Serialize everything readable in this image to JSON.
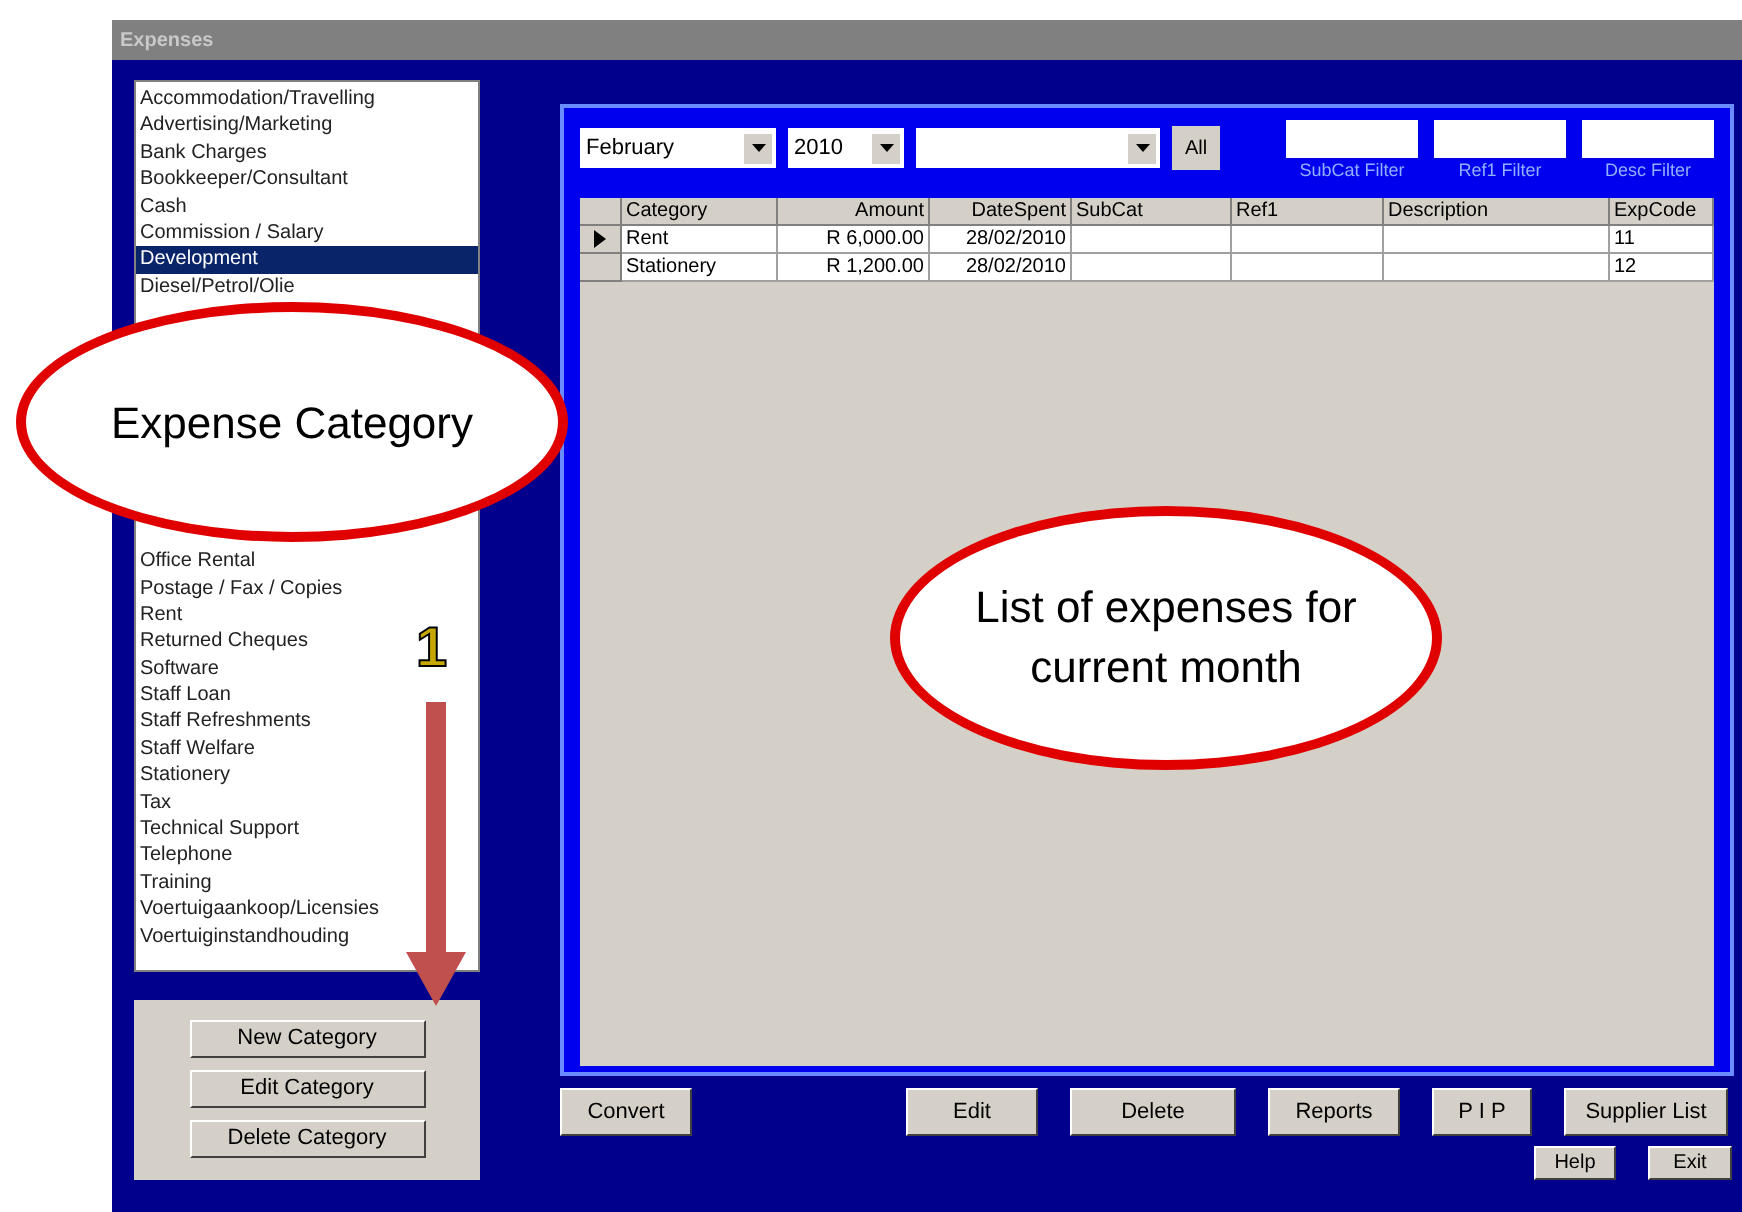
{
  "window": {
    "title": "Expenses"
  },
  "categories_top": [
    {
      "label": "Accommodation/Travelling",
      "selected": false
    },
    {
      "label": "Advertising/Marketing",
      "selected": false
    },
    {
      "label": "Bank Charges",
      "selected": false
    },
    {
      "label": "Bookkeeper/Consultant",
      "selected": false
    },
    {
      "label": "Cash",
      "selected": false
    },
    {
      "label": "Commission / Salary",
      "selected": false
    },
    {
      "label": "Development",
      "selected": true
    },
    {
      "label": "Diesel/Petrol/Olie",
      "selected": false
    }
  ],
  "categories_bottom": [
    {
      "label": "Office Rental",
      "selected": false
    },
    {
      "label": "Postage / Fax / Copies",
      "selected": false
    },
    {
      "label": "Rent",
      "selected": false
    },
    {
      "label": "Returned Cheques",
      "selected": false
    },
    {
      "label": "Software",
      "selected": false
    },
    {
      "label": "Staff Loan",
      "selected": false
    },
    {
      "label": "Staff Refreshments",
      "selected": false
    },
    {
      "label": "Staff Welfare",
      "selected": false
    },
    {
      "label": "Stationery",
      "selected": false
    },
    {
      "label": "Tax",
      "selected": false
    },
    {
      "label": "Technical Support",
      "selected": false
    },
    {
      "label": "Telephone",
      "selected": false
    },
    {
      "label": "Training",
      "selected": false
    },
    {
      "label": "Voertuigaankoop/Licensies",
      "selected": false
    },
    {
      "label": "Voertuiginstandhouding",
      "selected": false
    }
  ],
  "category_buttons": [
    "New Category",
    "Edit Category",
    "Delete Category"
  ],
  "filters": {
    "month": "February",
    "year": "2010",
    "all_button": "All",
    "labels": [
      "SubCat Filter",
      "Ref1 Filter",
      "Desc Filter"
    ]
  },
  "table": {
    "columns": [
      "Category",
      "Amount",
      "DateSpent",
      "SubCat",
      "Ref1",
      "Description",
      "ExpCode"
    ],
    "rows": [
      {
        "current": true,
        "cells": [
          "Rent",
          "R 6,000.00",
          "28/02/2010",
          "",
          "",
          "",
          "11"
        ]
      },
      {
        "current": false,
        "cells": [
          "Stationery",
          "R 1,200.00",
          "28/02/2010",
          "",
          "",
          "",
          "12"
        ]
      }
    ]
  },
  "action_buttons": [
    "Convert",
    "Edit",
    "Delete",
    "Reports",
    "P I P",
    "Supplier List"
  ],
  "footer_buttons": [
    "Help",
    "Exit"
  ],
  "callouts": [
    {
      "text": "Expense Category"
    },
    {
      "text": "List of expenses for current month"
    }
  ],
  "step_number": "1"
}
